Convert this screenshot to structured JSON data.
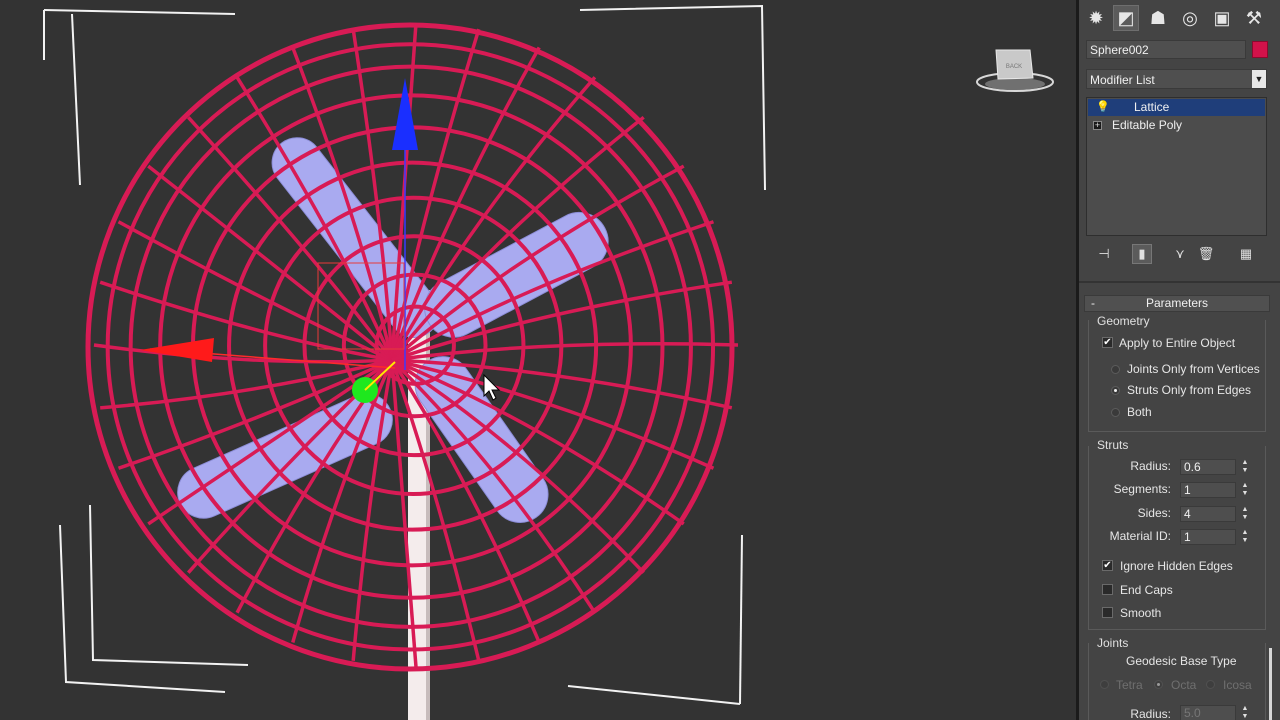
{
  "object": {
    "name": "Sphere002",
    "color": "#d2124a"
  },
  "modifier_list": {
    "label": "Modifier List",
    "arrow_icon": "dropdown-arrow-icon"
  },
  "stack": {
    "items": [
      {
        "label": "Lattice",
        "selected": true
      },
      {
        "label": "Editable Poly",
        "selected": false
      }
    ]
  },
  "viewcube": {
    "face_label": "BACK"
  },
  "parameters": {
    "title": "Parameters",
    "collapse_symbol": "-",
    "geometry": {
      "title": "Geometry",
      "apply_entire": {
        "label": "Apply to Entire Object",
        "checked": true
      },
      "options": [
        {
          "label": "Joints Only from Vertices",
          "selected": false
        },
        {
          "label": "Struts Only from Edges",
          "selected": true
        },
        {
          "label": "Both",
          "selected": false
        }
      ]
    },
    "struts": {
      "title": "Struts",
      "radius": {
        "label": "Radius:",
        "value": "0.6"
      },
      "segments": {
        "label": "Segments:",
        "value": "1"
      },
      "sides": {
        "label": "Sides:",
        "value": "4"
      },
      "material_id": {
        "label": "Material ID:",
        "value": "1"
      },
      "ignore_hidden": {
        "label": "Ignore Hidden Edges",
        "checked": true
      },
      "end_caps": {
        "label": "End Caps",
        "checked": false
      },
      "smooth": {
        "label": "Smooth",
        "checked": false
      }
    },
    "joints": {
      "title": "Joints",
      "base_type_label": "Geodesic Base Type",
      "base_types": [
        {
          "label": "Tetra",
          "selected": false
        },
        {
          "label": "Octa",
          "selected": true
        },
        {
          "label": "Icosa",
          "selected": false
        }
      ],
      "radius": {
        "label": "Radius:",
        "value": "5.0"
      }
    }
  },
  "colors": {
    "viewport_bg": "#333333",
    "panel_bg": "#444444",
    "lattice_wire": "#d81b55",
    "blade": "#a7a8ee",
    "selection_highlight": "#1f3e7a"
  }
}
